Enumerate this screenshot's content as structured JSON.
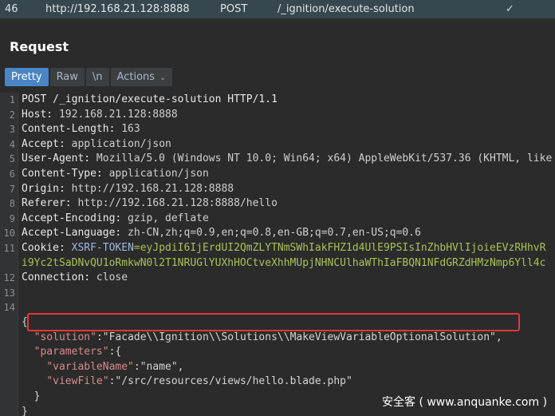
{
  "top_row": {
    "number": "46",
    "url": "http://192.168.21.128:8888",
    "method": "POST",
    "path": "/_ignition/execute-solution",
    "status_icon": "check-icon"
  },
  "title": "Request",
  "tabs": [
    {
      "label": "Pretty",
      "active": true
    },
    {
      "label": "Raw"
    },
    {
      "label": "\\n"
    },
    {
      "label": "Actions"
    }
  ],
  "lines": [
    {
      "n": "1",
      "parts": [
        [
          "POST /_ignition/execute-solution HTTP/1.1",
          "hname"
        ]
      ]
    },
    {
      "n": "2",
      "parts": [
        [
          "Host:",
          "hname"
        ],
        [
          " 192.168.21.128:8888",
          "hval"
        ]
      ]
    },
    {
      "n": "3",
      "parts": [
        [
          "Content-Length:",
          "hname"
        ],
        [
          " 163",
          "hval"
        ]
      ]
    },
    {
      "n": "4",
      "parts": [
        [
          "Accept:",
          "hname"
        ],
        [
          " application/json",
          "hval"
        ]
      ]
    },
    {
      "n": "5",
      "parts": [
        [
          "User-Agent:",
          "hname"
        ],
        [
          " Mozilla/5.0 (Windows NT 10.0; Win64; x64) AppleWebKit/537.36 (KHTML, like",
          "hval"
        ]
      ]
    },
    {
      "n": "6",
      "parts": [
        [
          "Content-Type:",
          "hname"
        ],
        [
          " application/json",
          "hval"
        ]
      ]
    },
    {
      "n": "7",
      "parts": [
        [
          "Origin:",
          "hname"
        ],
        [
          " http://192.168.21.128:8888",
          "hval"
        ]
      ]
    },
    {
      "n": "8",
      "parts": [
        [
          "Referer:",
          "hname"
        ],
        [
          " http://192.168.21.128:8888/hello",
          "hval"
        ]
      ]
    },
    {
      "n": "9",
      "parts": [
        [
          "Accept-Encoding:",
          "hname"
        ],
        [
          " gzip, deflate",
          "hval"
        ]
      ]
    },
    {
      "n": "10",
      "parts": [
        [
          "Accept-Language:",
          "hname"
        ],
        [
          " zh-CN,zh;q=0.9,en;q=0.8,en-GB;q=0.7,en-US;q=0.6",
          "hval"
        ]
      ]
    },
    {
      "n": "11",
      "parts": [
        [
          "Cookie:",
          "hname"
        ],
        [
          " XSRF-TOKEN",
          "cookie-name"
        ],
        [
          "=eyJpdiI6IjErdUI2QmZLYTNmSWhIakFHZ1d4UlE9PSIsInZhbHVlIjoieEVzRHhvR",
          "cookie-val"
        ]
      ]
    },
    {
      "n": "",
      "parts": [
        [
          "i9Yc2tSaDNvQU1oRmkwN0l2T1NRUGlYUXhHOCtveXhhMUpjNHNCUlhaWThIaFBQN1NFdGRZdHMzNmp6Yll4c",
          "cookie-val"
        ]
      ]
    },
    {
      "n": "12",
      "parts": [
        [
          "Connection:",
          "hname"
        ],
        [
          " close",
          "hval"
        ]
      ]
    },
    {
      "n": "13",
      "parts": [
        [
          "",
          "hval"
        ]
      ]
    },
    {
      "n": "14",
      "parts": [
        [
          "",
          "hval"
        ]
      ]
    },
    {
      "n": "",
      "parts": [
        [
          "{",
          "jstr"
        ]
      ]
    },
    {
      "n": "",
      "parts": [
        [
          "  ",
          "jstr"
        ],
        [
          "\"solution\"",
          "jkey"
        ],
        [
          ":\"Facade\\\\Ignition\\\\Solutions\\\\MakeViewVariableOptionalSolution\",",
          "jstr"
        ]
      ]
    },
    {
      "n": "",
      "parts": [
        [
          "  ",
          "jstr"
        ],
        [
          "\"parameters\"",
          "jkey"
        ],
        [
          ":{",
          "jstr"
        ]
      ]
    },
    {
      "n": "",
      "parts": [
        [
          "    ",
          "jstr"
        ],
        [
          "\"variableName\"",
          "jkey"
        ],
        [
          ":\"name\",",
          "jstr"
        ]
      ]
    },
    {
      "n": "",
      "parts": [
        [
          "    ",
          "jstr"
        ],
        [
          "\"viewFile\"",
          "jkey"
        ],
        [
          ":\"/src/resources/views/hello.blade.php\"",
          "jstr"
        ]
      ]
    },
    {
      "n": "",
      "parts": [
        [
          "  }",
          "jstr"
        ]
      ]
    },
    {
      "n": "",
      "parts": [
        [
          "}",
          "jstr"
        ]
      ]
    }
  ],
  "watermark": "安全客 ( www.anquanke.com )"
}
